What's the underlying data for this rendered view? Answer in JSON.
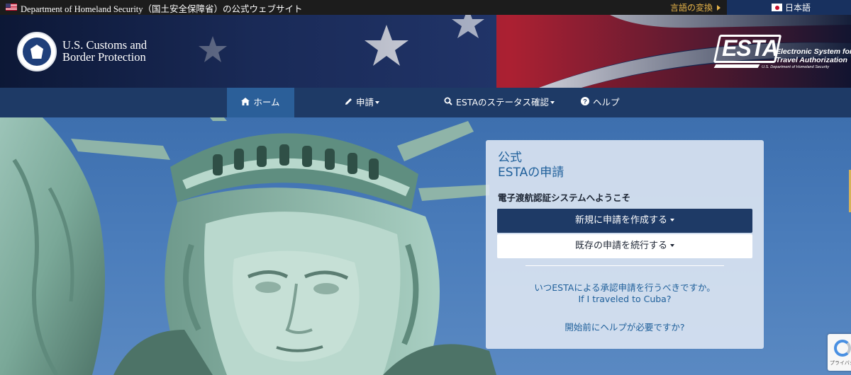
{
  "gov_bar": {
    "text": "Department of Homeland Security（国土安全保障省）の公式ウェブサイト",
    "language_switch": "言語の変換",
    "language": "日本語"
  },
  "header": {
    "agency_line1": "U.S. Customs and",
    "agency_line2": "Border Protection",
    "esta_badge": "ESTA",
    "esta_full_line1": "Electronic System for",
    "esta_full_line2": "Travel Authorization",
    "esta_sub": "U.S. Department of Homeland Security"
  },
  "nav": {
    "home": "ホーム",
    "apply": "申請",
    "status": "ESTAのステータス確認",
    "help": "ヘルプ"
  },
  "panel": {
    "title_line1": "公式",
    "title_line2": "ESTAの申請",
    "welcome": "電子渡航認証システムへようこそ",
    "new_application": "新規に申請を作成する",
    "continue_application": "既存の申請を続行する",
    "link_when": "いつESTAによる承認申請を行うべきですか。",
    "link_cuba": "If I traveled to Cuba?",
    "link_help": "開始前にヘルプが必要ですか?"
  },
  "recaptcha": {
    "text": "プライバシー・利用"
  },
  "colors": {
    "nav_bg": "#1e3a66",
    "nav_active": "#2b5f99",
    "link": "#1e5f9a",
    "accent_gold": "#e8b54a"
  },
  "icons": {
    "home": "home-icon",
    "apply": "pencil-icon",
    "status": "search-icon",
    "help": "question-circle-icon"
  }
}
